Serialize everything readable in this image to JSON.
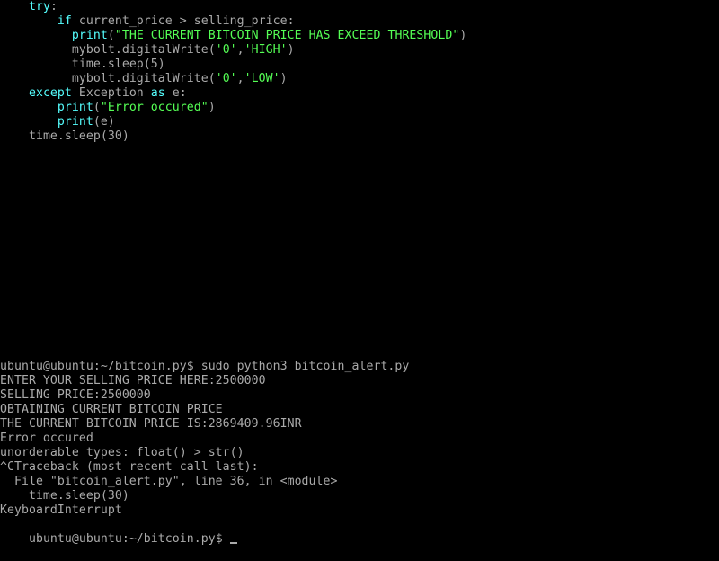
{
  "colors": {
    "background": "#000000",
    "text": "#aaaaaa",
    "keyword": "#55ffff",
    "string": "#55ff55"
  },
  "code": [
    {
      "indent": "    ",
      "segments": [
        {
          "t": "try",
          "k": "kw"
        },
        {
          "t": ":",
          "k": "plain"
        }
      ]
    },
    {
      "indent": "        ",
      "segments": [
        {
          "t": "if",
          "k": "kw"
        },
        {
          "t": " current_price > selling_price:",
          "k": "plain"
        }
      ]
    },
    {
      "indent": "          ",
      "segments": [
        {
          "t": "print",
          "k": "kw"
        },
        {
          "t": "(",
          "k": "plain"
        },
        {
          "t": "\"THE CURRENT BITCOIN PRICE HAS EXCEED THRESHOLD\"",
          "k": "str"
        },
        {
          "t": ")",
          "k": "plain"
        }
      ]
    },
    {
      "indent": "          ",
      "segments": [
        {
          "t": "mybolt.digitalWrite(",
          "k": "plain"
        },
        {
          "t": "'0'",
          "k": "str"
        },
        {
          "t": ",",
          "k": "plain"
        },
        {
          "t": "'HIGH'",
          "k": "str"
        },
        {
          "t": ")",
          "k": "plain"
        }
      ]
    },
    {
      "indent": "          ",
      "segments": [
        {
          "t": "time.sleep(5)",
          "k": "plain"
        }
      ]
    },
    {
      "indent": "          ",
      "segments": [
        {
          "t": "mybolt.digitalWrite(",
          "k": "plain"
        },
        {
          "t": "'0'",
          "k": "str"
        },
        {
          "t": ",",
          "k": "plain"
        },
        {
          "t": "'LOW'",
          "k": "str"
        },
        {
          "t": ")",
          "k": "plain"
        }
      ]
    },
    {
      "indent": "    ",
      "segments": [
        {
          "t": "except",
          "k": "kw"
        },
        {
          "t": " Exception ",
          "k": "plain"
        },
        {
          "t": "as",
          "k": "kw"
        },
        {
          "t": " e:",
          "k": "plain"
        }
      ]
    },
    {
      "indent": "        ",
      "segments": [
        {
          "t": "print",
          "k": "kw"
        },
        {
          "t": "(",
          "k": "plain"
        },
        {
          "t": "\"Error occured\"",
          "k": "str"
        },
        {
          "t": ")",
          "k": "plain"
        }
      ]
    },
    {
      "indent": "        ",
      "segments": [
        {
          "t": "print",
          "k": "kw"
        },
        {
          "t": "(e)",
          "k": "plain"
        }
      ]
    },
    {
      "indent": "    ",
      "segments": [
        {
          "t": "time.sleep(30)",
          "k": "plain"
        }
      ]
    }
  ],
  "terminal": {
    "lines": [
      "ubuntu@ubuntu:~/bitcoin.py$ sudo python3 bitcoin_alert.py",
      "ENTER YOUR SELLING PRICE HERE:2500000",
      "SELLING PRICE:2500000",
      "OBTAINING CURRENT BITCOIN PRICE",
      "THE CURRENT BITCOIN PRICE IS:2869409.96INR",
      "Error occured",
      "unorderable types: float() > str()",
      "^CTraceback (most recent call last):",
      "  File \"bitcoin_alert.py\", line 36, in <module>",
      "    time.sleep(30)",
      "KeyboardInterrupt"
    ],
    "prompt": "ubuntu@ubuntu:~/bitcoin.py$ "
  }
}
